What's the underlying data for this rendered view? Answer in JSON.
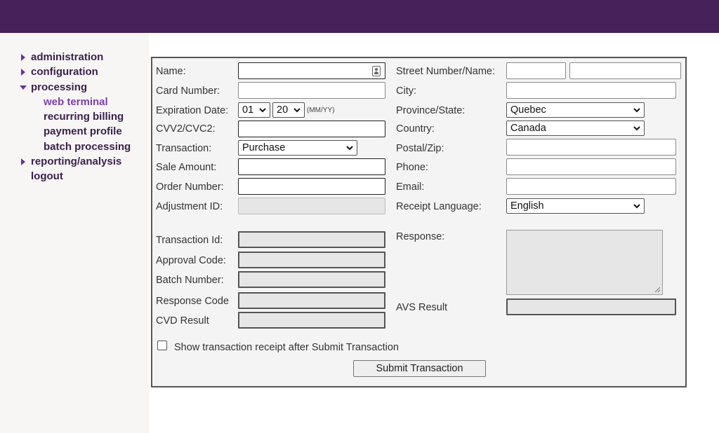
{
  "colors": {
    "topbar": "#46215a",
    "nav_text": "#3a1f4d",
    "nav_active": "#7a3fb0",
    "arrow": "#6b2fa0"
  },
  "nav": {
    "administration": "administration",
    "configuration": "configuration",
    "processing": "processing",
    "web_terminal": "web terminal",
    "recurring_billing": "recurring billing",
    "payment_profile": "payment profile",
    "batch_processing": "batch processing",
    "reporting_analysis": "reporting/analysis",
    "logout": "logout"
  },
  "form": {
    "name_label": "Name:",
    "card_number_label": "Card Number:",
    "expiration_label": "Expiration Date:",
    "exp_month": "01",
    "exp_year": "20",
    "exp_hint": "(MM/YY)",
    "cvv_label": "CVV2/CVC2:",
    "transaction_label": "Transaction:",
    "transaction_value": "Purchase",
    "sale_amount_label": "Sale Amount:",
    "order_number_label": "Order Number:",
    "adjustment_id_label": "Adjustment ID:",
    "street_label": "Street Number/Name:",
    "city_label": "City:",
    "province_label": "Province/State:",
    "province_value": "Quebec",
    "country_label": "Country:",
    "country_value": "Canada",
    "postal_label": "Postal/Zip:",
    "phone_label": "Phone:",
    "email_label": "Email:",
    "receipt_language_label": "Receipt Language:",
    "receipt_language_value": "English",
    "transaction_id_label": "Transaction Id:",
    "approval_code_label": "Approval Code:",
    "batch_number_label": "Batch Number:",
    "response_code_label": "Response Code",
    "cvd_result_label": "CVD Result",
    "response_label": "Response:",
    "avs_result_label": "AVS Result",
    "show_receipt_label": "Show transaction receipt after Submit Transaction",
    "submit_label": "Submit Transaction"
  }
}
